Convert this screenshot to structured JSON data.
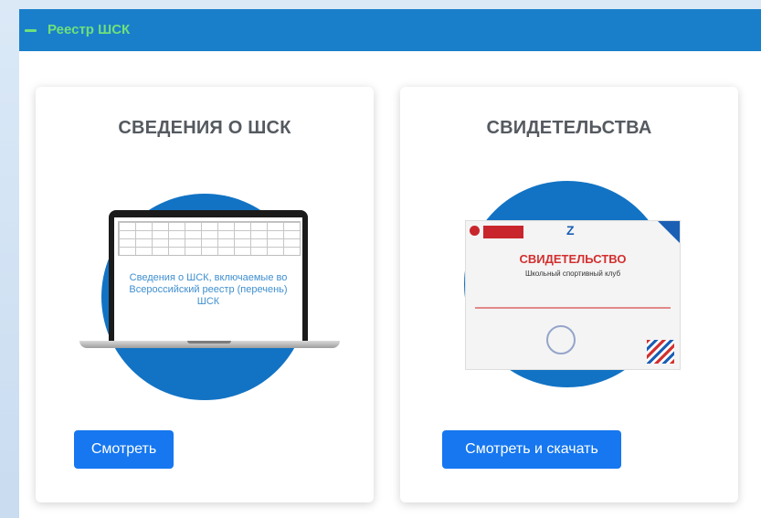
{
  "panel": {
    "title": "Реестр ШСК",
    "collapse_icon": "minus-icon",
    "header_color": "#1a7fcb",
    "title_color": "#6ee07a"
  },
  "cards": [
    {
      "title": "СВЕДЕНИЯ О ШСК",
      "image": "laptop-illustration",
      "screen_text": "Сведения о ШСК, включаемые во Всероссийский реестр (перечень) ШСК",
      "button_label": "Смотреть"
    },
    {
      "title": "СВИДЕТЕЛЬСТВА",
      "image": "certificate-illustration",
      "certificate_title": "СВИДЕТЕЛЬСТВО",
      "certificate_subtitle": "Школьный спортивный клуб",
      "button_label": "Смотреть и скачать"
    }
  ],
  "colors": {
    "button": "#1677f0",
    "circle": "#1273c4"
  }
}
